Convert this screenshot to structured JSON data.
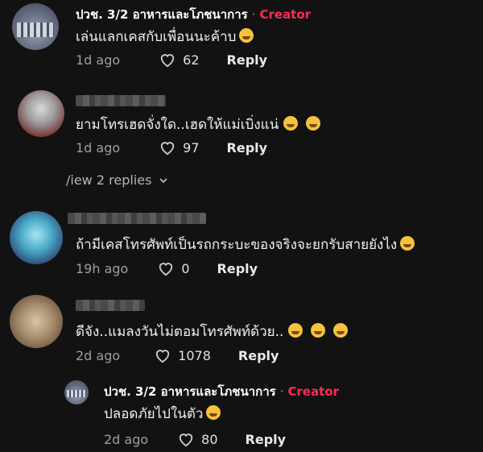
{
  "comments": [
    {
      "username": "ปวช. 3/2 อาหารและโภชนาการ",
      "badge": "Creator",
      "text": "เล่นแลกเคสกับเพื่อนนะค้าบ",
      "time": "1d ago",
      "likes": "62",
      "reply": "Reply",
      "emojis": [
        "grin"
      ]
    },
    {
      "username": "",
      "text": "ยามโทรเฮดจั่งใด..เฮดให้แม่เบิ่งแน่",
      "time": "1d ago",
      "likes": "97",
      "reply": "Reply",
      "emojis": [
        "heart-eyes",
        "heart-eyes"
      ]
    },
    {
      "username": "",
      "text": "ถ้ามีเคสโทรศัพท์เป็นรถกระบะของจริงจะยกรับสายยังไง",
      "time": "19h ago",
      "likes": "0",
      "reply": "Reply",
      "emojis": [
        "rofl"
      ]
    },
    {
      "username": "",
      "text": "ดีจัง..แมลงวันไม่ตอมโทรศัพท์ด้วย..",
      "time": "2d ago",
      "likes": "1078",
      "reply": "Reply",
      "emojis": [
        "sweat-smile",
        "grin",
        "grin"
      ]
    }
  ],
  "view_replies": "/iew 2 replies",
  "reply_comment": {
    "username": "ปวช. 3/2 อาหารและโภชนาการ",
    "badge": "Creator",
    "text": "ปลอดภัยไปในตัว",
    "time": "2d ago",
    "likes": "80",
    "reply": "Reply",
    "emojis": [
      "grin"
    ]
  },
  "colors": {
    "background": "#121212",
    "creator": "#fe2c55",
    "emoji": "#f6c23e"
  }
}
